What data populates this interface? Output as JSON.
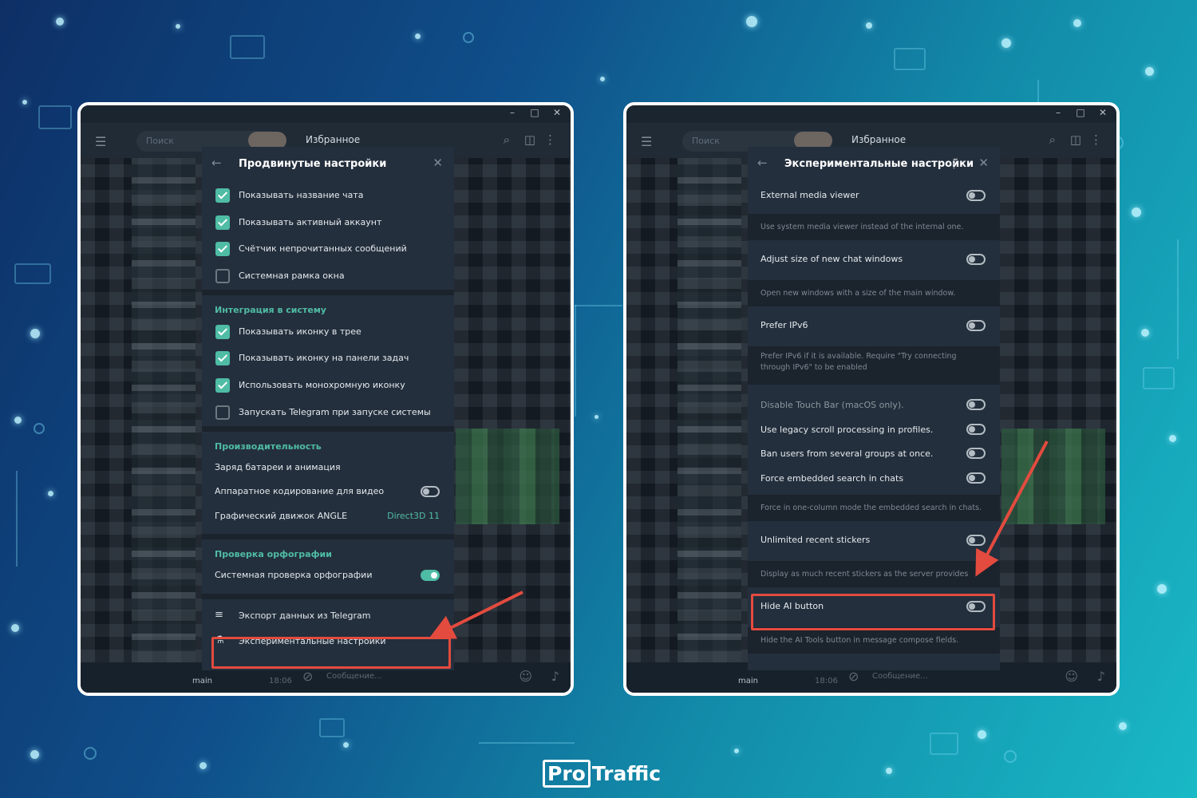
{
  "left_window": {
    "topbar": {
      "search_placeholder": "Поиск",
      "chat_title": "Избранное"
    },
    "panel": {
      "title": "Продвинутые настройки",
      "checkbox_rows": [
        {
          "label": "Показывать название чата",
          "checked": true
        },
        {
          "label": "Показывать активный аккаунт",
          "checked": true
        },
        {
          "label": "Счётчик непрочитанных сообщений",
          "checked": true
        },
        {
          "label": "Системная рамка окна",
          "checked": false
        }
      ],
      "integration": {
        "title": "Интеграция в систему",
        "rows": [
          {
            "label": "Показывать иконку в трее",
            "checked": true
          },
          {
            "label": "Показывать иконку на панели задач",
            "checked": true
          },
          {
            "label": "Использовать монохромную иконку",
            "checked": true
          },
          {
            "label": "Запускать Telegram при запуске системы",
            "checked": false
          }
        ]
      },
      "performance": {
        "title": "Производительность",
        "battery_label": "Заряд батареи и анимация",
        "hw_label": "Аппаратное кодирование для видео",
        "hw_enabled": false,
        "angle_label": "Графический движок ANGLE",
        "angle_value": "Direct3D 11"
      },
      "spelling": {
        "title": "Проверка орфографии",
        "system_label": "Системная проверка орфографии",
        "system_enabled": true
      },
      "export_label": "Экспорт данных из Telegram",
      "experimental_label": "Экспериментальные настройки"
    },
    "bottombar": {
      "chat_name": "main",
      "time": "18:06",
      "message_placeholder": "Сообщение..."
    }
  },
  "right_window": {
    "topbar": {
      "search_placeholder": "Поиск",
      "chat_title": "Избранное"
    },
    "panel": {
      "title": "Экспериментальные настройки",
      "items": [
        {
          "label": "External media viewer",
          "enabled": false,
          "desc": "Use system media viewer instead of the internal one."
        },
        {
          "label": "Adjust size of new chat windows",
          "enabled": false,
          "desc": "Open new windows with a size of the main window."
        },
        {
          "label": "Prefer IPv6",
          "enabled": false,
          "desc": "Prefer IPv6 if it is available. Require \"Try connecting through IPv6\" to be enabled"
        }
      ],
      "small_items": [
        {
          "label": "Disable Touch Bar (macOS only).",
          "enabled": false,
          "dim": true
        },
        {
          "label": "Use legacy scroll processing in profiles.",
          "enabled": false,
          "dim": false
        },
        {
          "label": "Ban users from several groups at once.",
          "enabled": false,
          "dim": false
        },
        {
          "label": "Force embedded search in chats",
          "enabled": false,
          "dim": false
        }
      ],
      "embedded_desc": "Force in one-column mode the embedded search in chats.",
      "stickers": {
        "label": "Unlimited recent stickers",
        "enabled": false,
        "desc": "Display as much recent stickers as the server provides"
      },
      "hide_ai": {
        "label": "Hide AI button",
        "enabled": false,
        "desc": "Hide the AI Tools button in message compose fields."
      }
    },
    "bottombar": {
      "chat_name": "main",
      "time": "18:06",
      "message_placeholder": "Сообщение..."
    }
  },
  "brand": {
    "pro": "Pro",
    "traffic": "Traffic"
  },
  "colors": {
    "accent": "#4fbca5",
    "highlight": "#e34b3f",
    "panel_bg": "#242f3d"
  }
}
